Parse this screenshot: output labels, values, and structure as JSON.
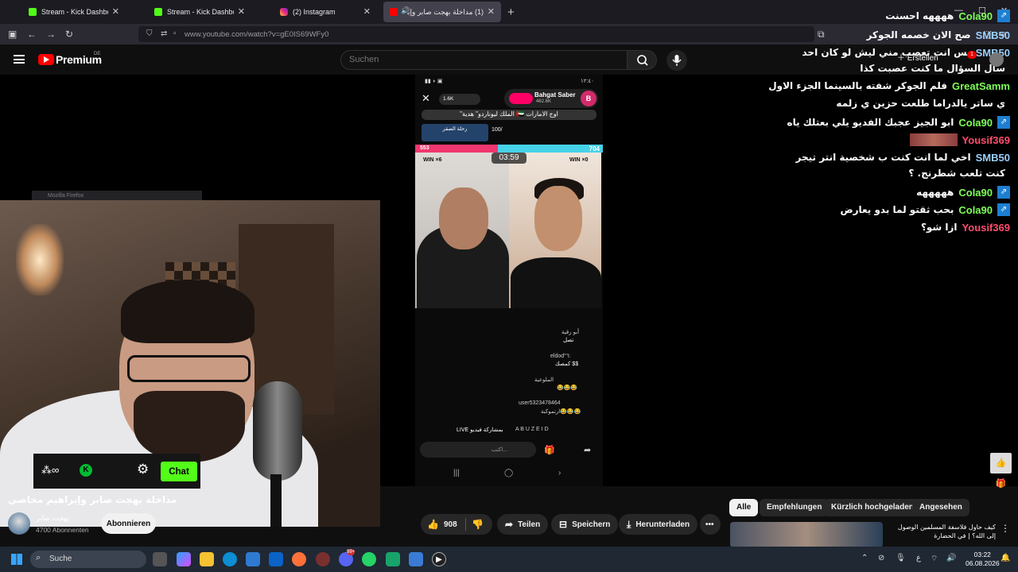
{
  "browser": {
    "tabs": [
      {
        "label": "Stream - Kick Dashboard",
        "favicon": "kick-icon"
      },
      {
        "label": "Stream - Kick Dashboard",
        "favicon": "kick-icon"
      },
      {
        "label": "(2) Instagram",
        "favicon": "instagram-icon"
      },
      {
        "label": "(1) مداخلة بهجت صابر وإبراه",
        "favicon": "youtube-icon",
        "active": true
      }
    ],
    "url": "www.youtube.com/watch?v=gE0IS69WFy0"
  },
  "youtube": {
    "brand": "Premium",
    "region": "DE",
    "search_placeholder": "Suchen",
    "create_label": "Erstellen",
    "notification_count": "1"
  },
  "phone": {
    "status_time": "١٢:٤٠",
    "viewers": "1.6K",
    "host_name": "Bahgat Saber",
    "host_followers": "462.6K",
    "host_initial": "B",
    "gift_banner": "\"الملك ليوناردو\" هدية 🇦🇪 اوج الامارات",
    "badge_title": "رحلة الصقر",
    "score": "100/",
    "score_left": "553",
    "score_right": "704",
    "timer": "03:59",
    "win_left": "WIN ×6",
    "win_right": "WIN ×0",
    "comments": [
      {
        "user": "أبو رقية",
        "text": "تصل"
      },
      {
        "user": "eldod°٦:",
        "text": "كمصك $$"
      },
      {
        "user": "الملوعية",
        "text": "😂😂😂"
      },
      {
        "user": "user5323478464",
        "text": "ارتموكبة😂😂😂"
      }
    ],
    "share_text": "LIVE بمشاركة فيديو",
    "letters": "A B U Z E I D",
    "input_placeholder": "اكتب..."
  },
  "cam": {
    "window_title": "Mozilla Firefox",
    "chat_button": "Chat"
  },
  "chat": [
    {
      "user": "Cola90",
      "color": "#7fff5a",
      "badge": true,
      "text": "ههههه احسنت"
    },
    {
      "user": "SMB50",
      "color": "#9bd0ff",
      "badge": false,
      "text": "صح الان خصمه الجوكر"
    },
    {
      "user": "SMB50",
      "color": "#9bd0ff",
      "badge": false,
      "text": "بس انت تعصب مني ليش لو كان احد"
    },
    {
      "user": "",
      "color": "#9bd0ff",
      "badge": false,
      "text": "سال السؤال ما كنت عصبت كذا"
    },
    {
      "user": "GreatSamm",
      "color": "#7fff5a",
      "badge": false,
      "text": "فلم الجوكر شفته بالسينما الجزء الاول"
    },
    {
      "user": "",
      "color": "#7fff5a",
      "badge": false,
      "text": "ي ساتر يالدراما طلعت حزين ي زلمه"
    },
    {
      "user": "Cola90",
      "color": "#7fff5a",
      "badge": true,
      "text": "ابو الجيز عجبك الفديو يلي بعتلك ياه"
    },
    {
      "user": "Yousif369",
      "color": "#ff4d6d",
      "badge": false,
      "text": ""
    },
    {
      "user": "SMB50",
      "color": "#9bd0ff",
      "badge": false,
      "text": "اخي لما انت كنت ب شخصية انتر تيجر"
    },
    {
      "user": "",
      "color": "#9bd0ff",
      "badge": false,
      "text": "كنت تلعب شطرنج. ؟"
    },
    {
      "user": "Cola90",
      "color": "#7fff5a",
      "badge": true,
      "text": "هههههه"
    },
    {
      "user": "Cola90",
      "color": "#7fff5a",
      "badge": true,
      "text": "بحب ثقتو لما بدو يعارض"
    },
    {
      "user": "Yousif369",
      "color": "#ff4d6d",
      "badge": false,
      "text": "ازا شو؟"
    }
  ],
  "video": {
    "title": "مداخلة بهجت صابر وإبراهيم مخاصي",
    "channel": "بهجت صابر",
    "subscribers": "4700 Abonnenten",
    "subscribe_label": "Abonnieren",
    "likes": "908",
    "share_label": "Teilen",
    "save_label": "Speichern",
    "download_label": "Herunterladen"
  },
  "filters": [
    "Alle",
    "Empfehlungen",
    "Kürzlich hochgeladen",
    "Angesehen"
  ],
  "recommended": {
    "title": "كيف حاول فلاسفة المسلمين الوصول إلى الله؟ | في الحضارة"
  },
  "taskbar": {
    "search_label": "Suche",
    "time": "03:22",
    "date": "06.08.2026",
    "mail_badge": "99+"
  }
}
